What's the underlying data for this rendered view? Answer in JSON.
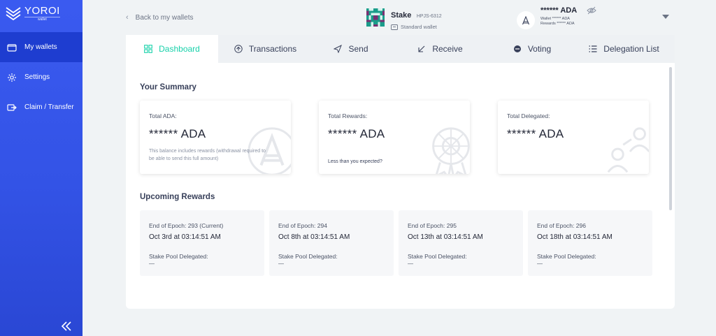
{
  "app": {
    "logo_text": "YOROI",
    "logo_sub": "wallet"
  },
  "sidebar": {
    "items": [
      {
        "label": "My wallets",
        "icon": "wallet-icon",
        "active": true
      },
      {
        "label": "Settings",
        "icon": "gear-icon",
        "active": false
      },
      {
        "label": "Claim / Transfer",
        "icon": "transfer-icon",
        "active": false
      }
    ],
    "collapse_icon": "double-chevron-left-icon"
  },
  "topbar": {
    "back_label": "Back to my wallets",
    "wallet_name": "Stake",
    "wallet_plate": "HPJS-6312",
    "wallet_type": "Standard wallet",
    "balance_main": "****** ADA",
    "balance_wallet": "Wallet ****** ADA",
    "balance_rewards": "Rewards ****** ADA"
  },
  "tabs": [
    {
      "label": "Dashboard",
      "icon": "dashboard-icon",
      "active": true
    },
    {
      "label": "Transactions",
      "icon": "transactions-icon",
      "active": false
    },
    {
      "label": "Send",
      "icon": "send-icon",
      "active": false
    },
    {
      "label": "Receive",
      "icon": "receive-icon",
      "active": false
    },
    {
      "label": "Voting",
      "icon": "voting-icon",
      "active": false
    },
    {
      "label": "Delegation List",
      "icon": "list-icon",
      "active": false
    }
  ],
  "summary": {
    "title": "Your Summary",
    "cards": [
      {
        "label": "Total ADA:",
        "amount": "****** ADA",
        "note": "This balance includes rewards (withdrawal required to be able to send this full amount)"
      },
      {
        "label": "Total Rewards:",
        "amount": "****** ADA",
        "link": "Less than you expected?"
      },
      {
        "label": "Total Delegated:",
        "amount": "****** ADA"
      }
    ]
  },
  "upcoming": {
    "title": "Upcoming Rewards",
    "cards": [
      {
        "epoch": "End of Epoch:  293 (Current)",
        "date": "Oct 3rd at 03:14:51 AM",
        "pool_label": "Stake Pool Delegated:",
        "pool_value": "—"
      },
      {
        "epoch": "End of Epoch:  294",
        "date": "Oct 8th at 03:14:51 AM",
        "pool_label": "Stake Pool Delegated:",
        "pool_value": "—"
      },
      {
        "epoch": "End of Epoch:  295",
        "date": "Oct 13th at 03:14:51 AM",
        "pool_label": "Stake Pool Delegated:",
        "pool_value": "—"
      },
      {
        "epoch": "End of Epoch:  296",
        "date": "Oct 18th at 03:14:51 AM",
        "pool_label": "Stake Pool Delegated:",
        "pool_value": "—"
      }
    ]
  },
  "colors": {
    "sidebar": "#3a5af0",
    "sidebar_active": "#1e3dd0",
    "accent": "#17d1aa",
    "text": "#242838"
  }
}
